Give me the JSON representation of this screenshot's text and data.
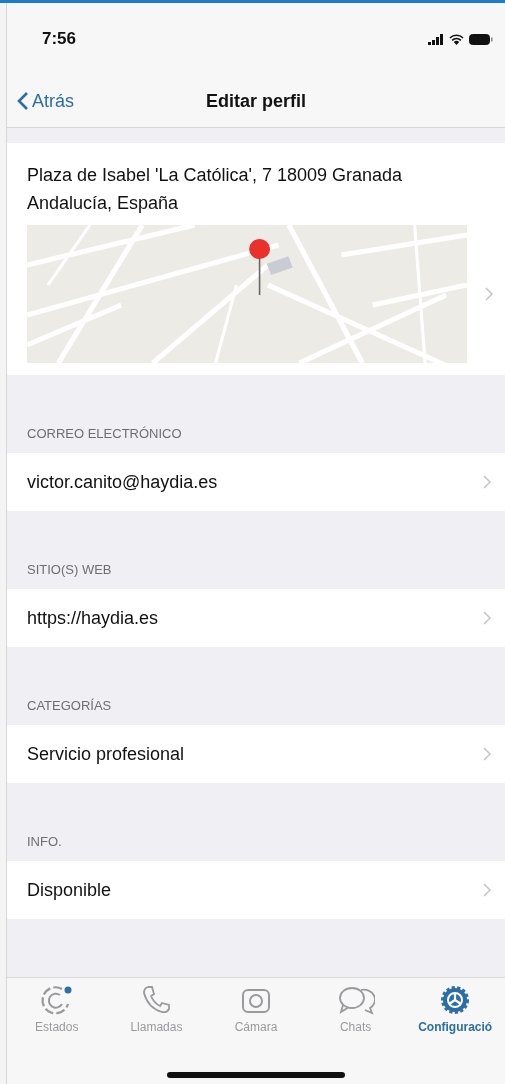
{
  "status_bar": {
    "time": "7:56"
  },
  "nav": {
    "back": "Atrás",
    "title": "Editar perfil"
  },
  "address": {
    "text": "Plaza de Isabel 'La Católica', 7 18009 Granada Andalucía, España"
  },
  "sections": [
    {
      "header": "CORREO ELECTRÓNICO",
      "value": "victor.canito@haydia.es"
    },
    {
      "header": "SITIO(S) WEB",
      "value": "https://haydia.es"
    },
    {
      "header": "CATEGORÍAS",
      "value": "Servicio profesional"
    },
    {
      "header": "INFO.",
      "value": "Disponible"
    }
  ],
  "tabs": [
    {
      "label": "Estados",
      "selected": false
    },
    {
      "label": "Llamadas",
      "selected": false
    },
    {
      "label": "Cámara",
      "selected": false
    },
    {
      "label": "Chats",
      "selected": false
    },
    {
      "label": "Configuració",
      "selected": true
    }
  ]
}
